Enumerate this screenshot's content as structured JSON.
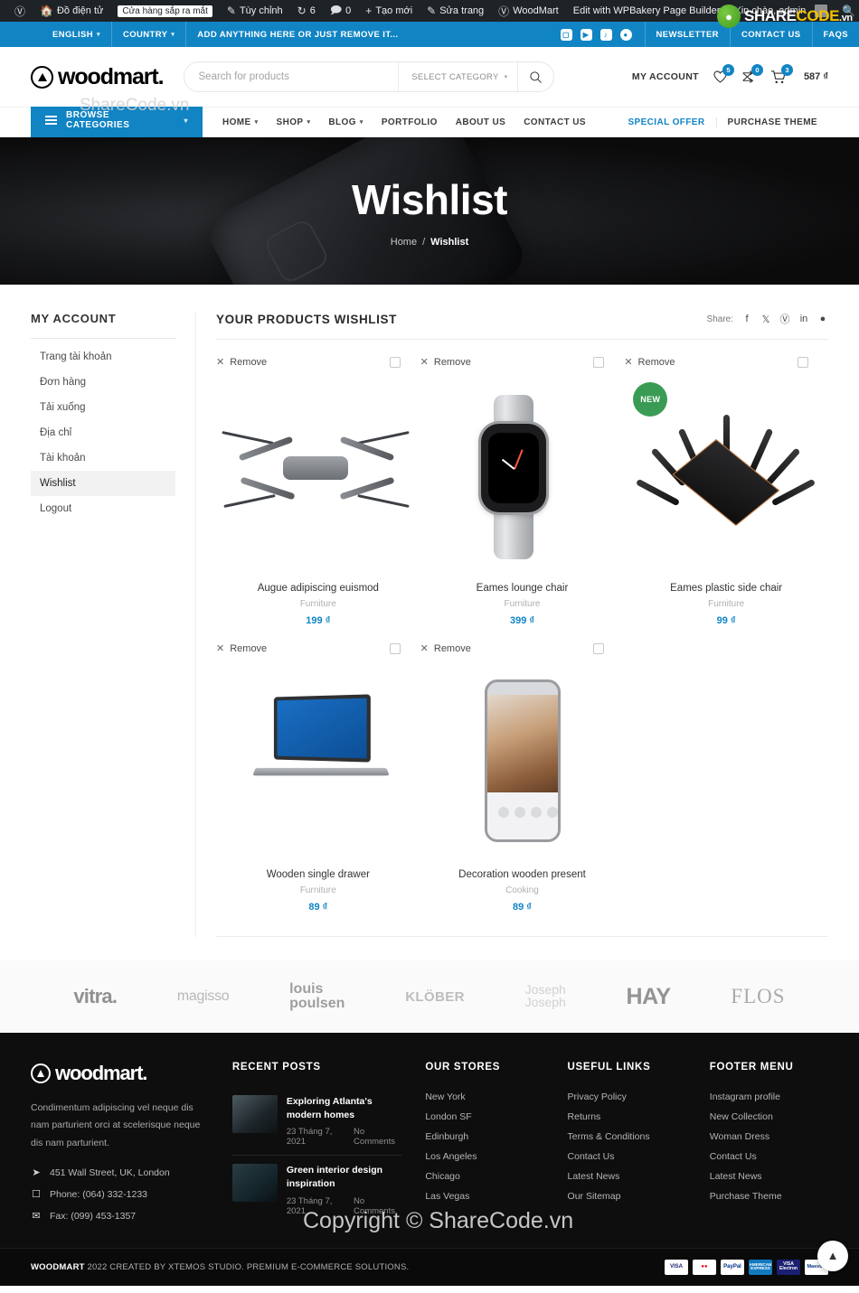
{
  "admin_bar": {
    "items": [
      {
        "icon": "wordpress-icon",
        "label": ""
      },
      {
        "icon": "home-icon",
        "label": "Đồ điện tử"
      },
      {
        "icon": "",
        "label": "Cửa hàng sắp ra mắt",
        "badge": true
      },
      {
        "icon": "pencil-icon",
        "label": "Tùy chỉnh"
      },
      {
        "icon": "refresh-icon",
        "label": "6"
      },
      {
        "icon": "comment-icon",
        "label": "0"
      },
      {
        "icon": "plus-icon",
        "label": "Tạo mới"
      },
      {
        "icon": "edit-icon",
        "label": "Sửa trang"
      },
      {
        "icon": "woodmart-icon",
        "label": "WoodMart"
      },
      {
        "icon": "",
        "label": "Edit with WPBakery Page Builder"
      }
    ],
    "greeting": "Xin chào, admin",
    "search_icon": "search-icon"
  },
  "topbar": {
    "language": "ENGLISH",
    "country": "COUNTRY",
    "promo": "ADD ANYTHING HERE OR JUST REMOVE IT...",
    "socials": [
      "instagram-icon",
      "youtube-icon",
      "tiktok-icon",
      "discord-icon"
    ],
    "links": [
      "NEWSLETTER",
      "CONTACT US",
      "FAQS"
    ]
  },
  "header": {
    "logo": "woodmart.",
    "search": {
      "placeholder": "Search for products",
      "category": "SELECT CATEGORY",
      "button_icon": "search-icon"
    },
    "my_account": "MY ACCOUNT",
    "wishlist_count": "5",
    "compare_count": "0",
    "cart_count": "3",
    "cart_total": "587 ₫"
  },
  "nav": {
    "browse_categories": "BROWSE CATEGORIES",
    "links": [
      {
        "label": "HOME",
        "has_caret": true
      },
      {
        "label": "SHOP",
        "has_caret": true
      },
      {
        "label": "BLOG",
        "has_caret": true
      },
      {
        "label": "PORTFOLIO",
        "has_caret": false
      },
      {
        "label": "ABOUT US",
        "has_caret": false
      },
      {
        "label": "CONTACT US",
        "has_caret": false
      }
    ],
    "special_offer": "SPECIAL OFFER",
    "purchase_theme": "PURCHASE THEME"
  },
  "hero": {
    "title": "Wishlist",
    "breadcrumb_home": "Home",
    "breadcrumb_sep": "/",
    "breadcrumb_current": "Wishlist"
  },
  "sidebar": {
    "title": "MY ACCOUNT",
    "items": [
      {
        "label": "Trang tài khoản",
        "active": false
      },
      {
        "label": "Đơn hàng",
        "active": false
      },
      {
        "label": "Tải xuống",
        "active": false
      },
      {
        "label": "Địa chỉ",
        "active": false
      },
      {
        "label": "Tài khoản",
        "active": false
      },
      {
        "label": "Wishlist",
        "active": true
      },
      {
        "label": "Logout",
        "active": false
      }
    ]
  },
  "wishlist": {
    "title": "YOUR PRODUCTS WISHLIST",
    "share_label": "Share:",
    "share_icons": [
      "facebook-icon",
      "x-twitter-icon",
      "pinterest-icon",
      "linkedin-icon",
      "telegram-icon"
    ],
    "remove_label": "Remove",
    "products": [
      {
        "name": "Augue adipiscing euismod",
        "category": "Furniture",
        "price": "199 ₫",
        "badge": "",
        "art": "drone"
      },
      {
        "name": "Eames lounge chair",
        "category": "Furniture",
        "price": "399 ₫",
        "badge": "",
        "art": "watch"
      },
      {
        "name": "Eames plastic side chair",
        "category": "Furniture",
        "price": "99 ₫",
        "badge": "NEW",
        "art": "router"
      },
      {
        "name": "Wooden single drawer",
        "category": "Furniture",
        "price": "89 ₫",
        "badge": "",
        "art": "laptop"
      },
      {
        "name": "Decoration wooden present",
        "category": "Cooking",
        "price": "89 ₫",
        "badge": "",
        "art": "phone"
      }
    ]
  },
  "brands": [
    "vitra.",
    "magisso",
    "louis poulsen",
    "KLÖBER",
    "Joseph Joseph",
    "HAY",
    "FLOS"
  ],
  "footer": {
    "logo": "woodmart.",
    "description": "Condimentum adipiscing vel neque dis nam parturient orci at scelerisque neque dis nam parturient.",
    "address": "451 Wall Street, UK, London",
    "phone": "Phone: (064) 332-1233",
    "fax": "Fax: (099) 453-1357",
    "recent_posts_title": "RECENT POSTS",
    "posts": [
      {
        "title": "Exploring Atlanta's modern homes",
        "date": "23 Tháng 7, 2021",
        "comments": "No Comments"
      },
      {
        "title": "Green interior design inspiration",
        "date": "23 Tháng 7, 2021",
        "comments": "No Comments"
      }
    ],
    "stores_title": "OUR STORES",
    "stores": [
      "New York",
      "London SF",
      "Edinburgh",
      "Los Angeles",
      "Chicago",
      "Las Vegas"
    ],
    "useful_title": "USEFUL LINKS",
    "useful": [
      "Privacy Policy",
      "Returns",
      "Terms & Conditions",
      "Contact Us",
      "Latest News",
      "Our Sitemap"
    ],
    "menu_title": "FOOTER MENU",
    "menu": [
      "Instagram profile",
      "New Collection",
      "Woman Dress",
      "Contact Us",
      "Latest News",
      "Purchase Theme"
    ],
    "copyright_brand": "WOODMART",
    "copyright_rest": "2022 CREATED BY XTEMOS STUDIO. PREMIUM E-COMMERCE SOLUTIONS.",
    "payments": [
      "VISA",
      "MasterCard",
      "PayPal",
      "AMERICAN EXPRESS",
      "VISA Electron",
      "Maestro"
    ],
    "to_top_icon": "chevron-up-icon"
  },
  "watermark": {
    "share": "SHARE",
    "code": "CODE",
    "vn": ".vn",
    "sub": "ShareCode.vn",
    "mid": "Copyright © ShareCode.vn"
  }
}
